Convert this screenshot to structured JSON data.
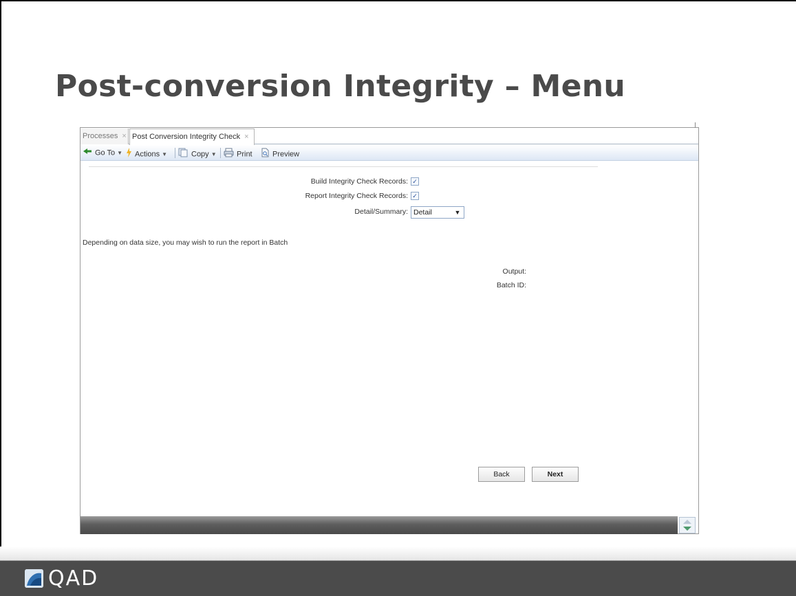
{
  "slide": {
    "title": "Post-conversion Integrity – Menu"
  },
  "app": {
    "tabs": [
      {
        "label": "Processes",
        "close": "×"
      },
      {
        "label": "Post Conversion Integrity Check",
        "close": "×"
      }
    ],
    "toolbar": {
      "goto_label": "Go To",
      "actions_label": "Actions",
      "copy_label": "Copy",
      "print_label": "Print",
      "preview_label": "Preview"
    },
    "form": {
      "build_label": "Build Integrity Check Records:",
      "build_checked": true,
      "report_label": "Report Integrity Check Records:",
      "report_checked": true,
      "detail_label": "Detail/Summary:",
      "detail_value": "Detail",
      "note": "Depending on data size, you may wish to run the report in Batch",
      "output_label": "Output:",
      "batch_label": "Batch ID:"
    },
    "buttons": {
      "back": "Back",
      "next": "Next"
    }
  },
  "footer": {
    "brand": "QAD"
  },
  "colors": {
    "title": "#4a4a4a",
    "footer_bg": "#4b4b4b",
    "toolbar_gradient_end": "#dde7f5"
  }
}
